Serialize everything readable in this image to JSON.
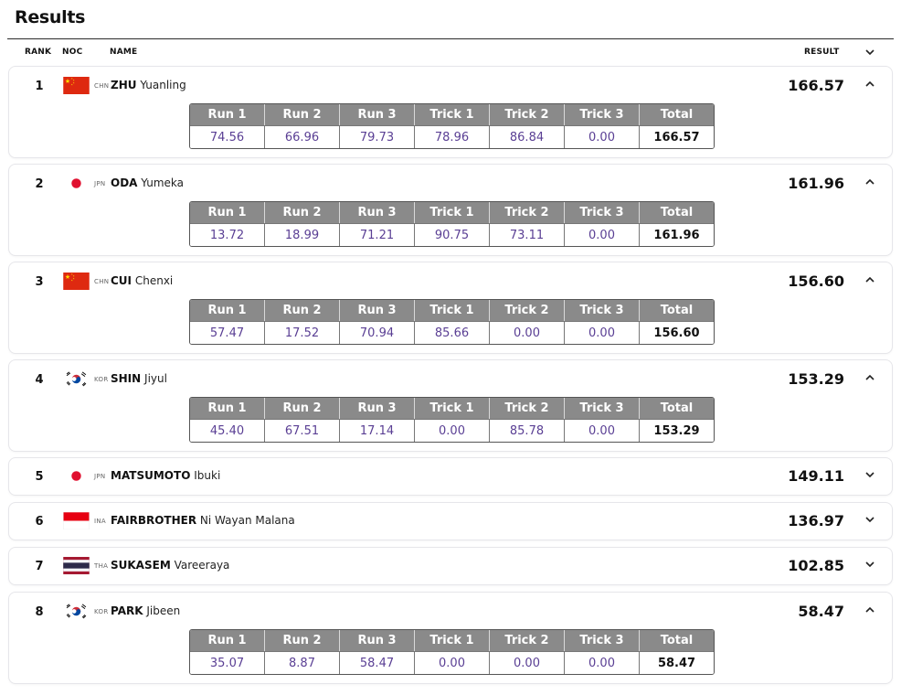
{
  "page": {
    "title": "Results"
  },
  "columns": {
    "rank": "RANK",
    "noc": "NOC",
    "name": "NAME",
    "result": "RESULT"
  },
  "run_headers": [
    "Run 1",
    "Run 2",
    "Run 3",
    "Trick 1",
    "Trick 2",
    "Trick 3",
    "Total"
  ],
  "athletes": [
    {
      "rank": "1",
      "noc": "CHN",
      "last": "ZHU",
      "first": "Yuanling",
      "result": "166.57",
      "expanded": true,
      "scores": [
        "74.56",
        "66.96",
        "79.73",
        "78.96",
        "86.84",
        "0.00",
        "166.57"
      ]
    },
    {
      "rank": "2",
      "noc": "JPN",
      "last": "ODA",
      "first": "Yumeka",
      "result": "161.96",
      "expanded": true,
      "scores": [
        "13.72",
        "18.99",
        "71.21",
        "90.75",
        "73.11",
        "0.00",
        "161.96"
      ]
    },
    {
      "rank": "3",
      "noc": "CHN",
      "last": "CUI",
      "first": "Chenxi",
      "result": "156.60",
      "expanded": true,
      "scores": [
        "57.47",
        "17.52",
        "70.94",
        "85.66",
        "0.00",
        "0.00",
        "156.60"
      ]
    },
    {
      "rank": "4",
      "noc": "KOR",
      "last": "SHIN",
      "first": "Jiyul",
      "result": "153.29",
      "expanded": true,
      "scores": [
        "45.40",
        "67.51",
        "17.14",
        "0.00",
        "85.78",
        "0.00",
        "153.29"
      ]
    },
    {
      "rank": "5",
      "noc": "JPN",
      "last": "MATSUMOTO",
      "first": "Ibuki",
      "result": "149.11",
      "expanded": false
    },
    {
      "rank": "6",
      "noc": "INA",
      "last": "FAIRBROTHER",
      "first": "Ni Wayan Malana",
      "result": "136.97",
      "expanded": false
    },
    {
      "rank": "7",
      "noc": "THA",
      "last": "SUKASEM",
      "first": "Vareeraya",
      "result": "102.85",
      "expanded": false
    },
    {
      "rank": "8",
      "noc": "KOR",
      "last": "PARK",
      "first": "Jibeen",
      "result": "58.47",
      "expanded": true,
      "scores": [
        "35.07",
        "8.87",
        "58.47",
        "0.00",
        "0.00",
        "0.00",
        "58.47"
      ]
    }
  ],
  "icons": {
    "expanded": "chevron-up-icon",
    "collapsed": "chevron-down-icon",
    "header": "chevron-down-icon"
  },
  "colors": {
    "score_text": "#5a3f94",
    "table_header_bg": "#8a8a8a",
    "flag_red": "#de2910",
    "flag_gold": "#ffde00"
  }
}
